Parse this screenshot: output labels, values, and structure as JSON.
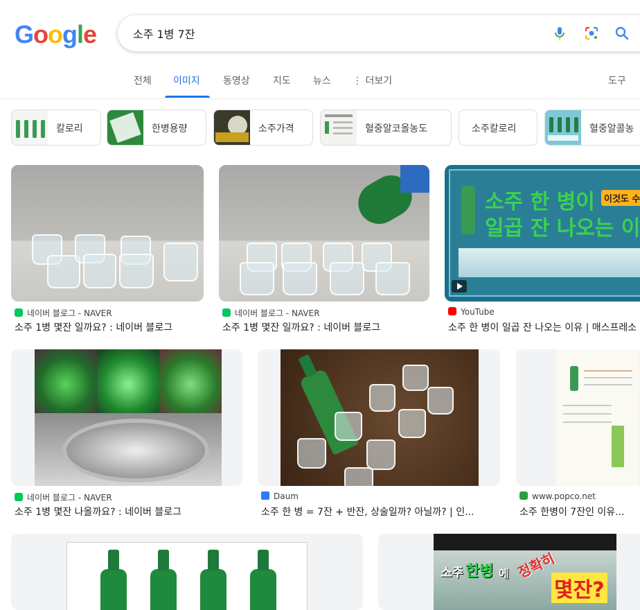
{
  "search": {
    "query": "소주 1병 7잔"
  },
  "tabs": [
    {
      "label": "전체"
    },
    {
      "label": "이미지"
    },
    {
      "label": "동영상"
    },
    {
      "label": "지도"
    },
    {
      "label": "뉴스"
    },
    {
      "label": "더보기"
    }
  ],
  "tools_label": "도구",
  "chips": [
    {
      "label": "칼로리"
    },
    {
      "label": "한병용량"
    },
    {
      "label": "소주가격"
    },
    {
      "label": "혈중알코올농도"
    },
    {
      "label": "소주칼로리"
    },
    {
      "label": "혈중알콜농"
    }
  ],
  "results": [
    {
      "source": "네이버 블로그 - NAVER",
      "title": "소주 1병 몇잔 일까요? : 네이버 블로그"
    },
    {
      "source": "네이버 블로그 - NAVER",
      "title": "소주 1병 몇잔 일까요? : 네이버 블로그"
    },
    {
      "source": "YouTube",
      "title": "소주 한 병이 일곱 잔 나오는 이유 | 매스프레소",
      "overlay_line1": "소주 한 병이",
      "overlay_line2": "일곱 잔 나오는 이유",
      "overlay_badge": "이것도 수"
    },
    {
      "source": "네이버 블로그 - NAVER",
      "title": "소주 1병 몇잔 나올까요? : 네이버 블로그"
    },
    {
      "source": "Daum",
      "title": "소주 한 병 = 7잔 + 반잔, 상술일까? 아닐까? | 인..."
    },
    {
      "source": "www.popco.net",
      "title": "소주 한병이 7잔인 이유..."
    }
  ],
  "row3": [
    {
      "overlay": ""
    },
    {
      "overlay_a": "소주",
      "overlay_b": "한병",
      "overlay_c": "에",
      "overlay_d": "정확히",
      "overlay_e": "몇잔?"
    }
  ],
  "colors": {
    "accent": "#1a73e8",
    "naver": "#03c75a",
    "youtube": "#ff0000",
    "daum": "#2f7cf6",
    "popco": "#2e9d3f"
  }
}
